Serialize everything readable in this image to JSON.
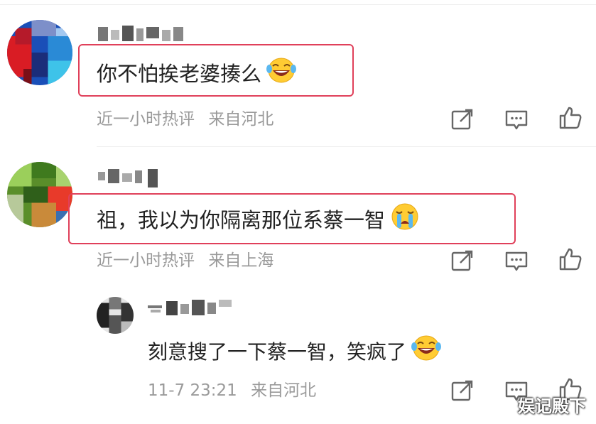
{
  "comments": [
    {
      "text": "你不怕挨老婆揍么",
      "emoji": "laughing-tears-emoji",
      "time": "近一小时热评",
      "location": "来自河北"
    },
    {
      "text": "祖，我以为你隔离那位系蔡一智",
      "emoji": "crying-emoji",
      "time": "近一小时热评",
      "location": "来自上海"
    }
  ],
  "reply": {
    "text": "刻意搜了一下蔡一智，笑疯了",
    "emoji": "laughing-tears-emoji",
    "time": "11-7 23:21",
    "location": "来自河北"
  },
  "actions": [
    "share-icon",
    "comment-icon",
    "thumbs-up-icon"
  ],
  "watermark": "娱记殿下",
  "colors": {
    "highlight_border": "#e0405a",
    "meta_text": "#9a9a9a",
    "body_text": "#222222"
  }
}
